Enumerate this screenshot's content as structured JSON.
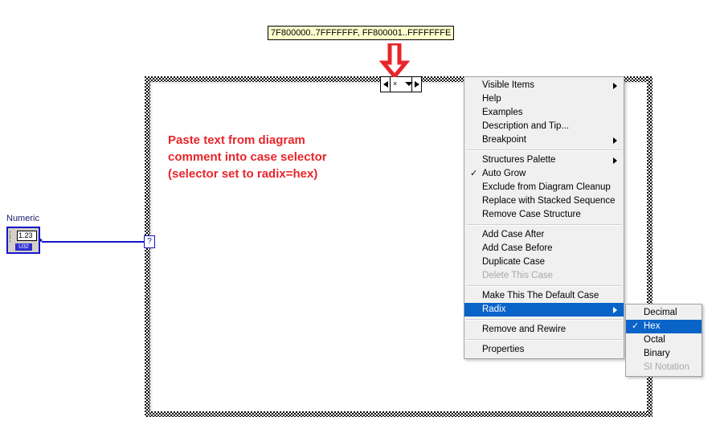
{
  "diagram_comment": {
    "text": "7F800000..7FFFFFFF, FF800001..FFFFFFFE"
  },
  "annotation": {
    "line1": "Paste text from diagram",
    "line2": "comment into case selector",
    "line3": "(selector set to radix=hex)",
    "color": "#e8252a"
  },
  "case_selector": {
    "left_arrow": "◄",
    "right_arrow": "►",
    "down_arrow": "▼",
    "caret": "×",
    "value": ""
  },
  "numeric_terminal": {
    "label": "Numeric",
    "value": "1.23",
    "datatype": "U32",
    "wire_color": "#1616c8"
  },
  "selector_terminal": {
    "symbol": "?"
  },
  "context_menu": {
    "items": [
      {
        "label": "Visible Items",
        "submenu": true,
        "checked": false,
        "disabled": false,
        "separator_after": false
      },
      {
        "label": "Help",
        "submenu": false,
        "checked": false,
        "disabled": false,
        "separator_after": false
      },
      {
        "label": "Examples",
        "submenu": false,
        "checked": false,
        "disabled": false,
        "separator_after": false
      },
      {
        "label": "Description and Tip...",
        "submenu": false,
        "checked": false,
        "disabled": false,
        "separator_after": false
      },
      {
        "label": "Breakpoint",
        "submenu": true,
        "checked": false,
        "disabled": false,
        "separator_after": true
      },
      {
        "label": "Structures Palette",
        "submenu": true,
        "checked": false,
        "disabled": false,
        "separator_after": false
      },
      {
        "label": "Auto Grow",
        "submenu": false,
        "checked": true,
        "disabled": false,
        "separator_after": false
      },
      {
        "label": "Exclude from Diagram Cleanup",
        "submenu": false,
        "checked": false,
        "disabled": false,
        "separator_after": false
      },
      {
        "label": "Replace with Stacked Sequence",
        "submenu": false,
        "checked": false,
        "disabled": false,
        "separator_after": false
      },
      {
        "label": "Remove Case Structure",
        "submenu": false,
        "checked": false,
        "disabled": false,
        "separator_after": true
      },
      {
        "label": "Add Case After",
        "submenu": false,
        "checked": false,
        "disabled": false,
        "separator_after": false
      },
      {
        "label": "Add Case Before",
        "submenu": false,
        "checked": false,
        "disabled": false,
        "separator_after": false
      },
      {
        "label": "Duplicate Case",
        "submenu": false,
        "checked": false,
        "disabled": false,
        "separator_after": false
      },
      {
        "label": "Delete This Case",
        "submenu": false,
        "checked": false,
        "disabled": true,
        "separator_after": true
      },
      {
        "label": "Make This The Default Case",
        "submenu": false,
        "checked": false,
        "disabled": false,
        "separator_after": false
      },
      {
        "label": "Radix",
        "submenu": true,
        "checked": false,
        "disabled": false,
        "selected": true,
        "separator_after": true
      },
      {
        "label": "Remove and Rewire",
        "submenu": false,
        "checked": false,
        "disabled": false,
        "separator_after": true
      },
      {
        "label": "Properties",
        "submenu": false,
        "checked": false,
        "disabled": false,
        "separator_after": false
      }
    ],
    "check_glyph": "✓",
    "highlight_color": "#0a64c8"
  },
  "radix_submenu": {
    "items": [
      {
        "label": "Decimal",
        "checked": false,
        "disabled": false,
        "selected": false
      },
      {
        "label": "Hex",
        "checked": true,
        "disabled": false,
        "selected": true
      },
      {
        "label": "Octal",
        "checked": false,
        "disabled": false,
        "selected": false
      },
      {
        "label": "Binary",
        "checked": false,
        "disabled": false,
        "selected": false
      },
      {
        "label": "SI Notation",
        "checked": false,
        "disabled": true,
        "selected": false
      }
    ]
  }
}
